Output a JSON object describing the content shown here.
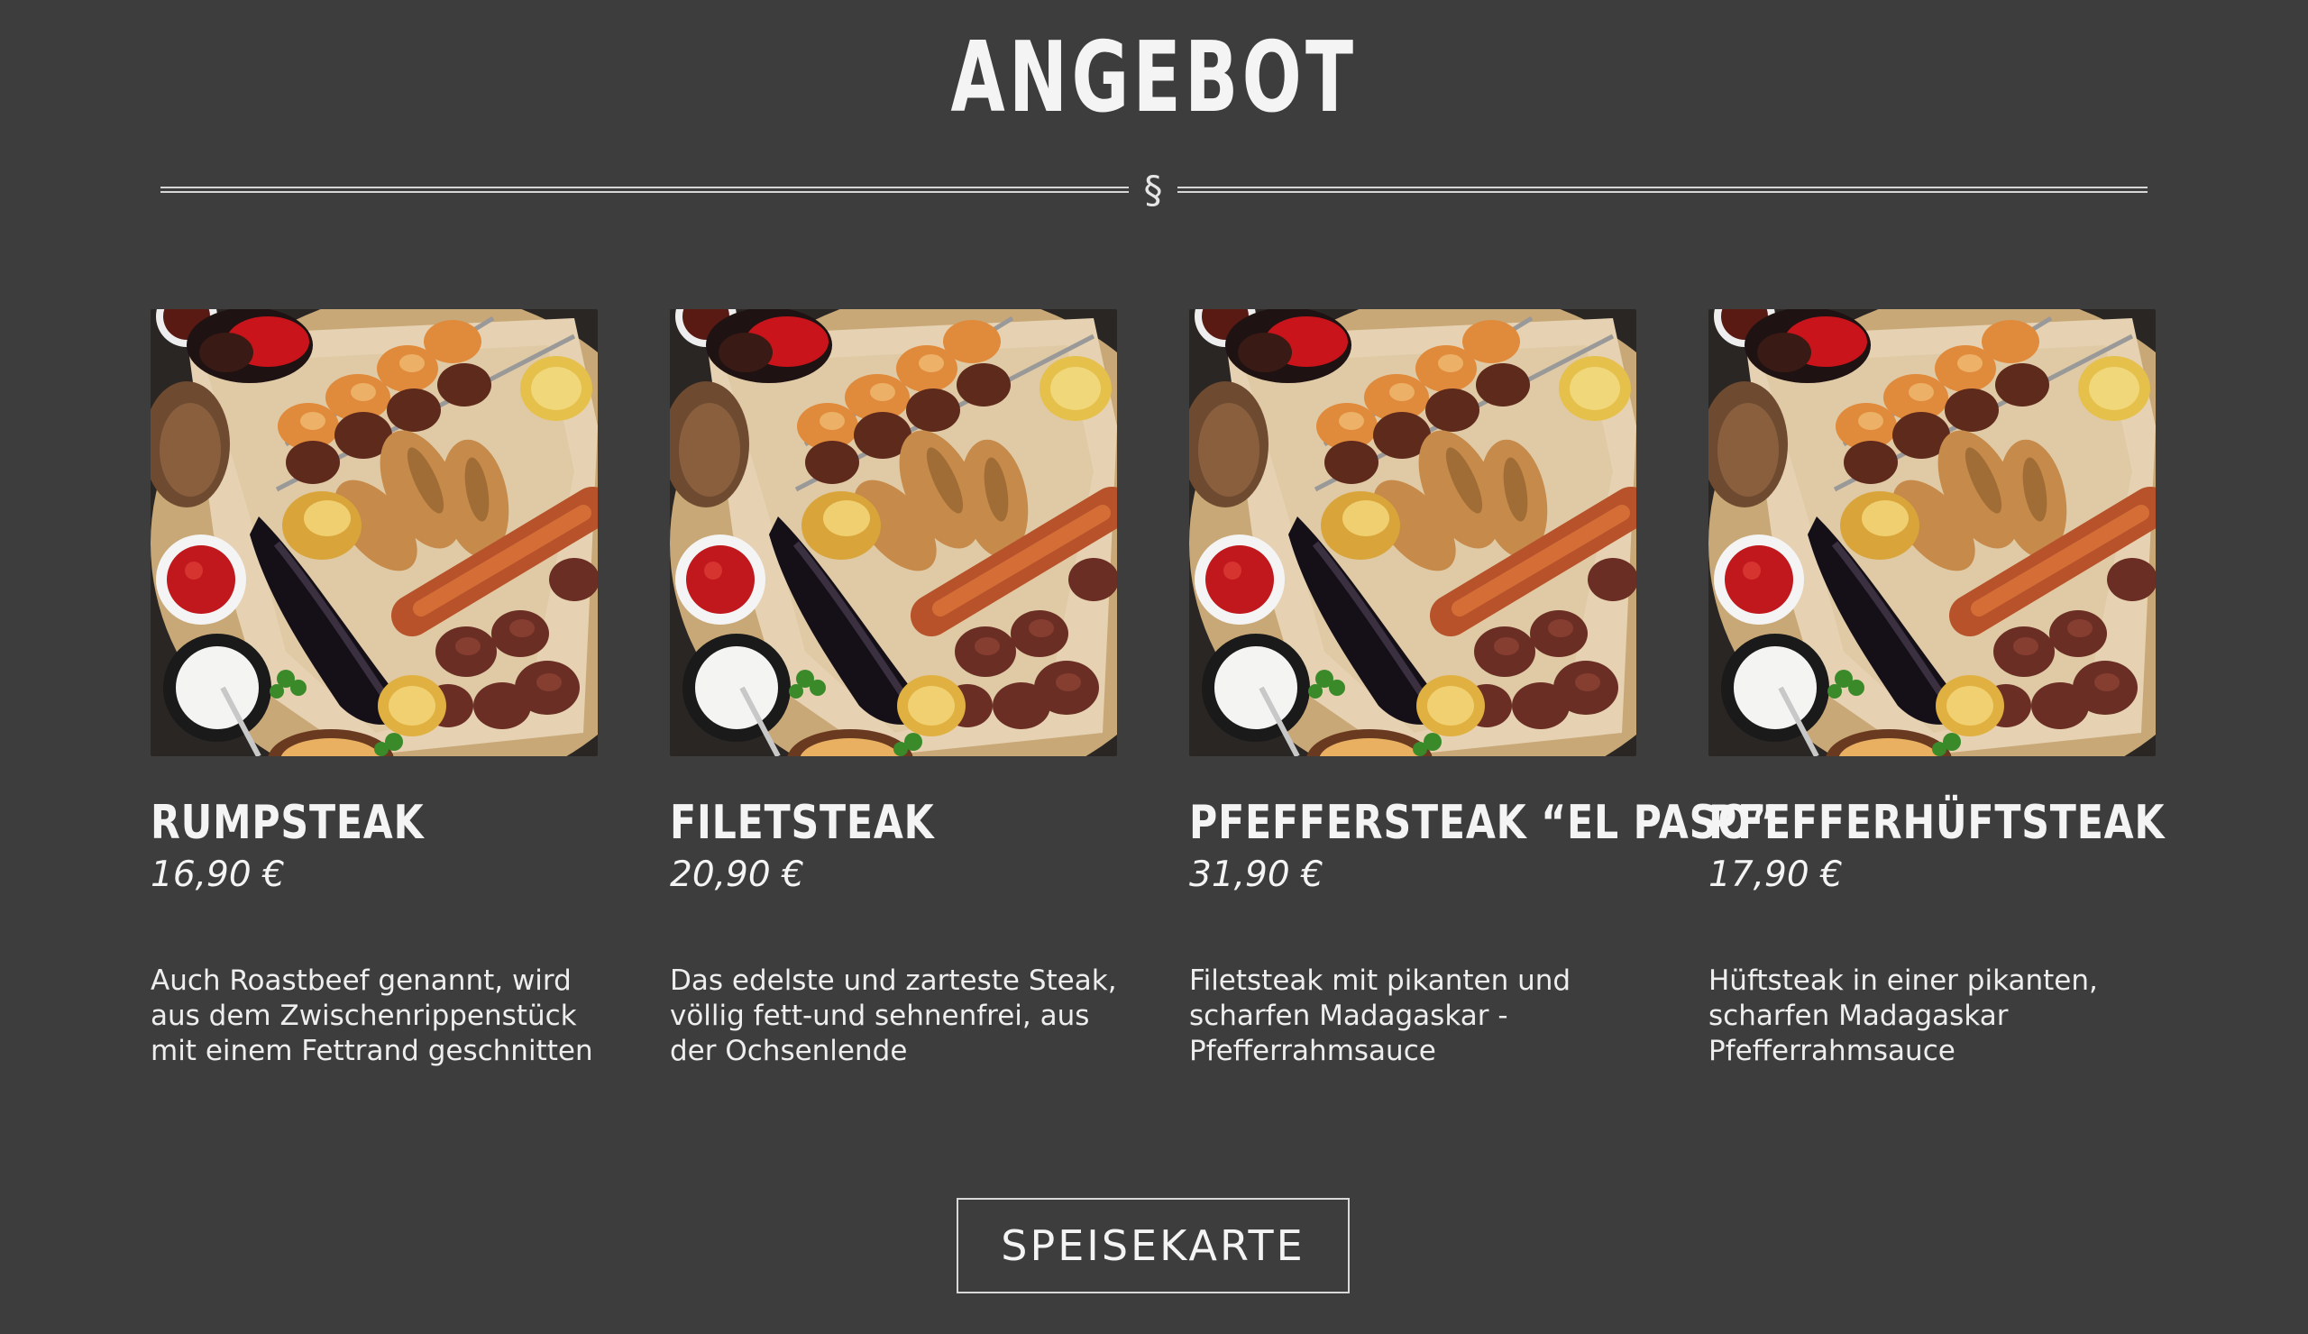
{
  "section": {
    "title": "ANGEBOT",
    "divider_symbol": "§"
  },
  "items": [
    {
      "title": "RUMPSTEAK",
      "price": "16,90 €",
      "description": "Auch Roastbeef genannt, wird aus dem Zwischenrippenstück mit einem Fettrand geschnitten",
      "image": "grill-platter-photo"
    },
    {
      "title": "FILETSTEAK",
      "price": "20,90 €",
      "description": "Das edelste und zarteste Steak, völlig fett-und sehnenfrei, aus der Ochsenlende",
      "image": "grill-platter-photo"
    },
    {
      "title": "PFEFFERSTEAK “EL PASO”",
      "price": "31,90 €",
      "description": "Filetsteak mit pikanten und scharfen Madagaskar - Pfefferrahmsauce",
      "image": "grill-platter-photo"
    },
    {
      "title": "PFEFFERHÜFTSTEAK",
      "price": "17,90 €",
      "description": "Hüftsteak in einer pikanten, scharfen Madagaskar Pfefferrahmsauce",
      "image": "grill-platter-photo"
    }
  ],
  "button": {
    "label": "SPEISEKARTE"
  },
  "colors": {
    "background": "#3d3d3d",
    "text": "#f4f4f4",
    "divider": "#d6d6d6"
  }
}
